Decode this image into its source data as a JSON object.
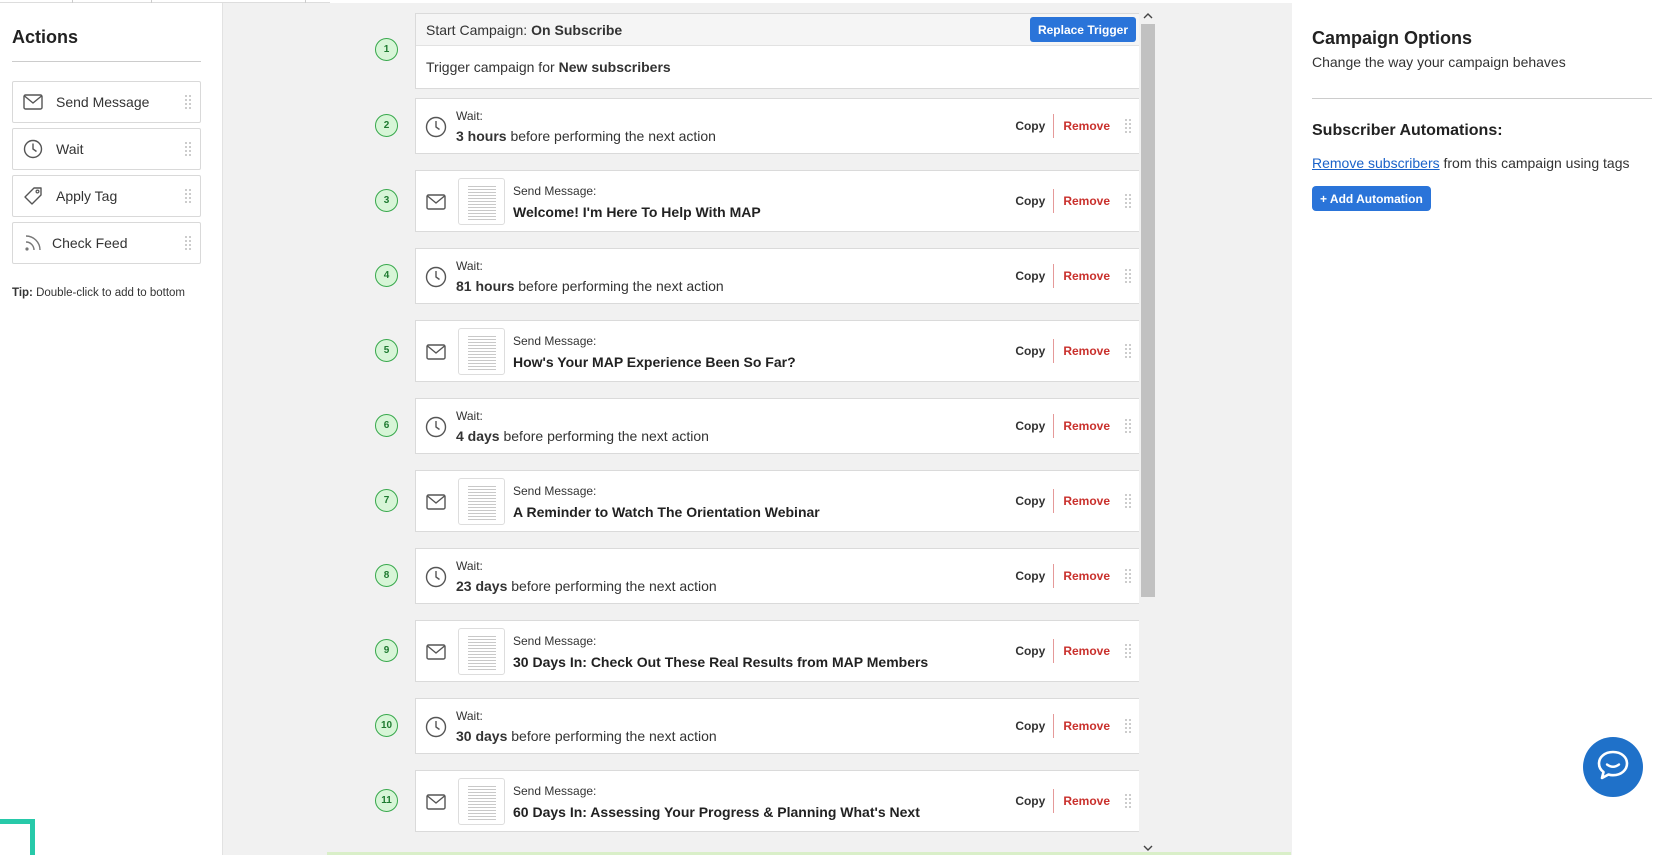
{
  "sidebar": {
    "title": "Actions",
    "items": [
      {
        "label": "Send Message",
        "icon": "envelope-icon"
      },
      {
        "label": "Wait",
        "icon": "clock-icon"
      },
      {
        "label": "Apply Tag",
        "icon": "tag-icon"
      },
      {
        "label": "Check Feed",
        "icon": "rss-feed-icon"
      }
    ],
    "tip_label": "Tip:",
    "tip_text": "Double-click to add to bottom"
  },
  "trigger": {
    "step": "1",
    "head_prefix": "Start Campaign:",
    "head_value": "On Subscribe",
    "replace_label": "Replace Trigger",
    "body_prefix": "Trigger campaign for",
    "body_value": "New subscribers"
  },
  "steps": [
    {
      "num": "2",
      "kind": "wait",
      "label": "Wait:",
      "amount": "3 hours",
      "suffix": "before performing the next action"
    },
    {
      "num": "3",
      "kind": "message",
      "label": "Send Message:",
      "title": "Welcome! I'm Here To Help With MAP"
    },
    {
      "num": "4",
      "kind": "wait",
      "label": "Wait:",
      "amount": "81 hours",
      "suffix": "before performing the next action"
    },
    {
      "num": "5",
      "kind": "message",
      "label": "Send Message:",
      "title": "How's Your MAP Experience Been So Far?"
    },
    {
      "num": "6",
      "kind": "wait",
      "label": "Wait:",
      "amount": "4 days",
      "suffix": "before performing the next action"
    },
    {
      "num": "7",
      "kind": "message",
      "label": "Send Message:",
      "title": "A Reminder to Watch The Orientation Webinar"
    },
    {
      "num": "8",
      "kind": "wait",
      "label": "Wait:",
      "amount": "23 days",
      "suffix": "before performing the next action"
    },
    {
      "num": "9",
      "kind": "message",
      "label": "Send Message:",
      "title": "30 Days In: Check Out These Real Results from MAP Members"
    },
    {
      "num": "10",
      "kind": "wait",
      "label": "Wait:",
      "amount": "30 days",
      "suffix": "before performing the next action"
    },
    {
      "num": "11",
      "kind": "message",
      "label": "Send Message:",
      "title": "60 Days In: Assessing Your Progress & Planning What's Next"
    }
  ],
  "step_controls": {
    "copy_label": "Copy",
    "remove_label": "Remove"
  },
  "options": {
    "title": "Campaign Options",
    "subtitle": "Change the way your campaign behaves",
    "automations_heading": "Subscriber Automations:",
    "automations_link": "Remove subscribers",
    "automations_rest": "from this campaign using tags",
    "add_automation_label": "+ Add Automation"
  },
  "colors": {
    "accent": "#2a74d9",
    "remove": "#c9302c",
    "step_green": "#37a84b"
  }
}
